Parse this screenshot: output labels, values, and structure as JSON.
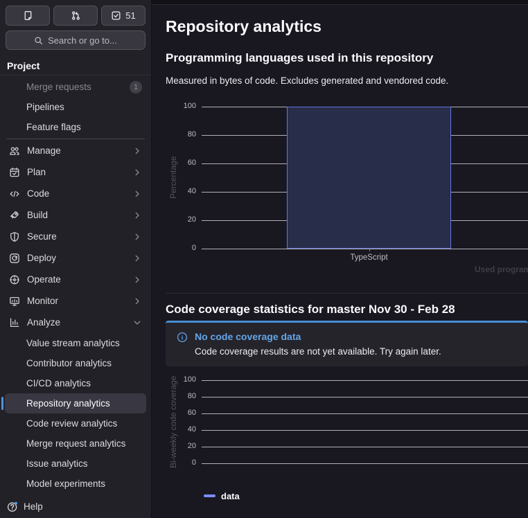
{
  "topbar": {
    "shortcut_buttons": [
      {
        "icon": "issues-icon"
      },
      {
        "icon": "merge-request-icon"
      },
      {
        "icon": "todo-checkmark-icon",
        "count": "51"
      }
    ],
    "search_label": "Search or go to..."
  },
  "sidebar": {
    "section_label": "Project",
    "items": [
      {
        "label": "Merge requests",
        "type": "sub",
        "dimmed": true,
        "badge": "1"
      },
      {
        "label": "Pipelines",
        "type": "sub"
      },
      {
        "label": "Feature flags",
        "type": "sub"
      },
      {
        "type": "divider"
      },
      {
        "label": "Manage",
        "type": "section",
        "icon": "users-icon",
        "chevron": "right"
      },
      {
        "label": "Plan",
        "type": "section",
        "icon": "calendar-icon",
        "chevron": "right"
      },
      {
        "label": "Code",
        "type": "section",
        "icon": "code-icon",
        "chevron": "right"
      },
      {
        "label": "Build",
        "type": "section",
        "icon": "rocket-icon",
        "chevron": "right"
      },
      {
        "label": "Secure",
        "type": "section",
        "icon": "shield-icon",
        "chevron": "right"
      },
      {
        "label": "Deploy",
        "type": "section",
        "icon": "deploy-icon",
        "chevron": "right"
      },
      {
        "label": "Operate",
        "type": "section",
        "icon": "operate-icon",
        "chevron": "right"
      },
      {
        "label": "Monitor",
        "type": "section",
        "icon": "monitor-icon",
        "chevron": "right"
      },
      {
        "label": "Analyze",
        "type": "section",
        "icon": "chart-icon",
        "chevron": "down",
        "expanded": true
      },
      {
        "label": "Value stream analytics",
        "type": "sub"
      },
      {
        "label": "Contributor analytics",
        "type": "sub"
      },
      {
        "label": "CI/CD analytics",
        "type": "sub"
      },
      {
        "label": "Repository analytics",
        "type": "sub",
        "active": true
      },
      {
        "label": "Code review analytics",
        "type": "sub"
      },
      {
        "label": "Merge request analytics",
        "type": "sub"
      },
      {
        "label": "Issue analytics",
        "type": "sub"
      },
      {
        "label": "Model experiments",
        "type": "sub"
      }
    ],
    "help": {
      "label": "Help",
      "icon": "help-icon"
    }
  },
  "main": {
    "page_title": "Repository analytics",
    "languages_section": {
      "title": "Programming languages used in this repository",
      "subtitle": "Measured in bytes of code. Excludes generated and vendored code."
    },
    "coverage_section": {
      "title": "Code coverage statistics for master Nov 30 - Feb 28",
      "alert_title": "No code coverage data",
      "alert_body": "Code coverage results are not yet available. Try again later."
    }
  },
  "chart_data": [
    {
      "type": "bar",
      "title": "Programming languages used in this repository",
      "categories": [
        "TypeScript"
      ],
      "values": [
        100
      ],
      "xlabel": "Used programming languages",
      "ylabel": "Percentage",
      "ylim": [
        0,
        100
      ],
      "yticks": [
        0,
        20,
        40,
        60,
        80,
        100
      ],
      "grid": true,
      "bar_fill": "#282d49",
      "bar_border": "#6176dc"
    },
    {
      "type": "line",
      "title": "Code coverage statistics for master Nov 30 - Feb 28",
      "x": [],
      "series": [
        {
          "name": "data",
          "values": []
        }
      ],
      "ylabel": "Bi-weekly code coverage",
      "ylim": [
        0,
        100
      ],
      "yticks": [
        0,
        20,
        40,
        60,
        80,
        100
      ],
      "grid": true,
      "legend_position": "bottom",
      "legend_color": "#7c8cf8"
    }
  ],
  "colors": {
    "accent_blue": "#63a6e9",
    "active_indicator": "#4f93da",
    "alert_top_border": "#478fd3",
    "bar_fill": "#282d49",
    "bar_border": "#6176dc",
    "legend_swatch": "#7c8cf8"
  }
}
